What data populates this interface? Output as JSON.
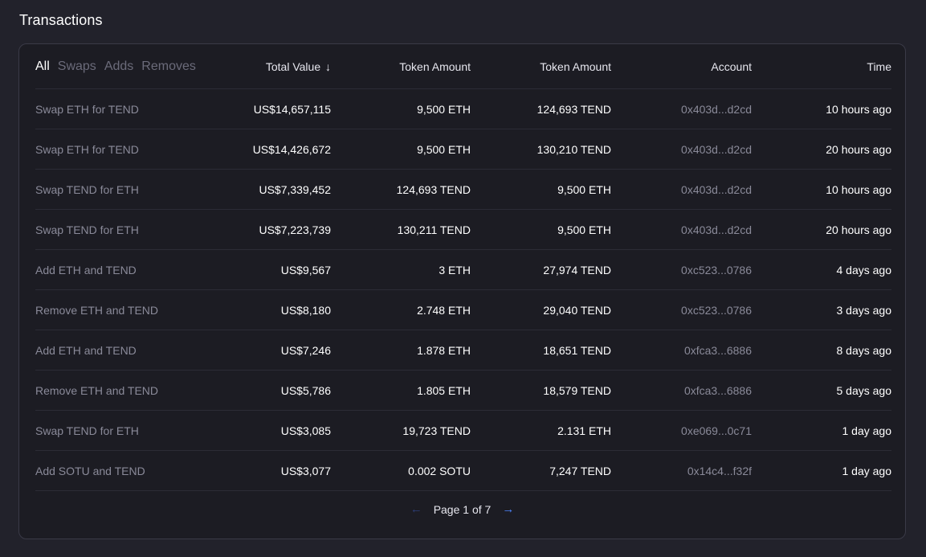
{
  "title": "Transactions",
  "filters": [
    "All",
    "Swaps",
    "Adds",
    "Removes"
  ],
  "columns": {
    "total_value": "Total Value",
    "total_value_sort_icon": "arrow-down-icon",
    "token_amount_1": "Token Amount",
    "token_amount_2": "Token Amount",
    "account": "Account",
    "time": "Time"
  },
  "rows": [
    [
      "Swap ETH for TEND",
      "US$14,657,115",
      "9,500 ETH",
      "124,693 TEND",
      "0x403d...d2cd",
      "10 hours ago"
    ],
    [
      "Swap ETH for TEND",
      "US$14,426,672",
      "9,500 ETH",
      "130,210 TEND",
      "0x403d...d2cd",
      "20 hours ago"
    ],
    [
      "Swap TEND for ETH",
      "US$7,339,452",
      "124,693 TEND",
      "9,500 ETH",
      "0x403d...d2cd",
      "10 hours ago"
    ],
    [
      "Swap TEND for ETH",
      "US$7,223,739",
      "130,211 TEND",
      "9,500 ETH",
      "0x403d...d2cd",
      "20 hours ago"
    ],
    [
      "Add ETH and TEND",
      "US$9,567",
      "3 ETH",
      "27,974 TEND",
      "0xc523...0786",
      "4 days ago"
    ],
    [
      "Remove ETH and TEND",
      "US$8,180",
      "2.748 ETH",
      "29,040 TEND",
      "0xc523...0786",
      "3 days ago"
    ],
    [
      "Add ETH and TEND",
      "US$7,246",
      "1.878 ETH",
      "18,651 TEND",
      "0xfca3...6886",
      "8 days ago"
    ],
    [
      "Remove ETH and TEND",
      "US$5,786",
      "1.805 ETH",
      "18,579 TEND",
      "0xfca3...6886",
      "5 days ago"
    ],
    [
      "Swap TEND for ETH",
      "US$3,085",
      "19,723 TEND",
      "2.131 ETH",
      "0xe069...0c71",
      "1 day ago"
    ],
    [
      "Add SOTU and TEND",
      "US$3,077",
      "0.002 SOTU",
      "7,247 TEND",
      "0x14c4...f32f",
      "1 day ago"
    ]
  ],
  "pagination": {
    "label": "Page 1 of 7",
    "prev_icon": "arrow-left-icon",
    "next_icon": "arrow-right-icon",
    "prev_glyph": "←",
    "next_glyph": "→"
  },
  "colors": {
    "background": "#22222b",
    "card": "#1c1c23",
    "muted_text": "#8a8a99",
    "accent": "#4c82fb"
  }
}
